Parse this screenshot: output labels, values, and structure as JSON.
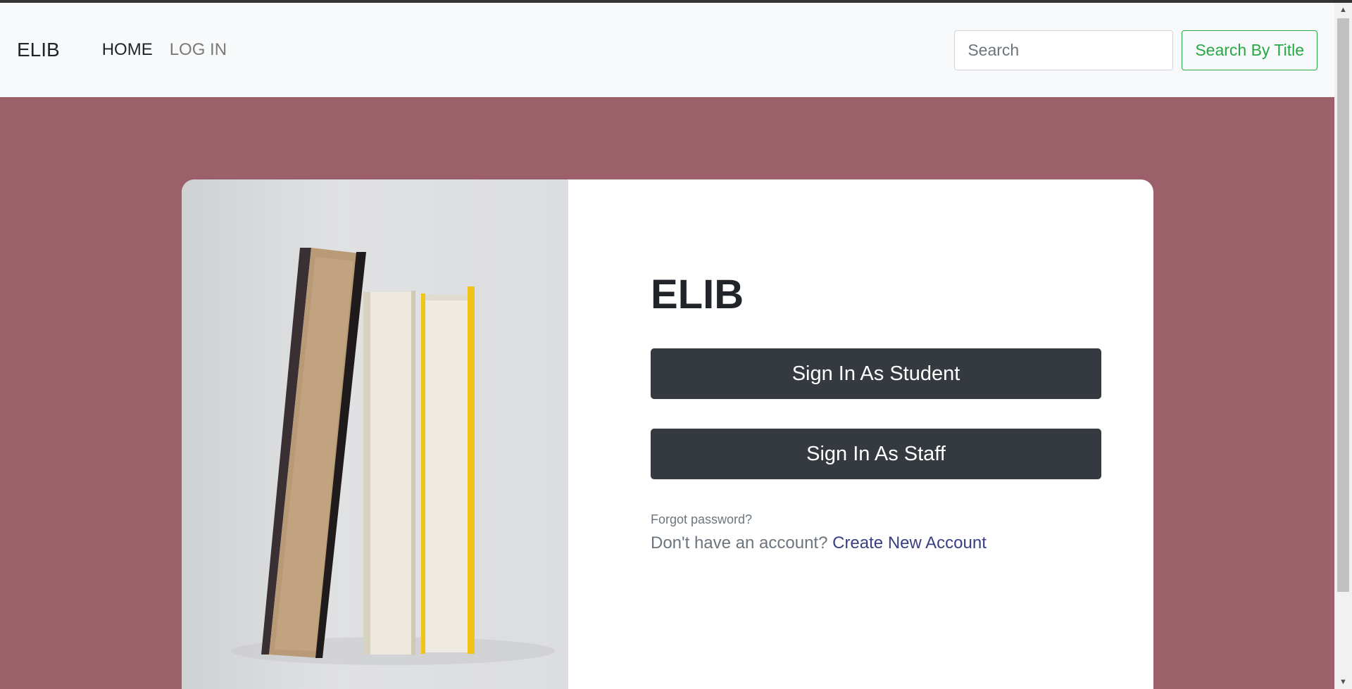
{
  "navbar": {
    "brand": "ELIB",
    "links": {
      "home": "HOME",
      "login": "LOG IN"
    },
    "search": {
      "placeholder": "Search",
      "button": "Search By Title"
    }
  },
  "card": {
    "title": "ELIB",
    "student_button": "Sign In As Student",
    "staff_button": "Sign In As Staff",
    "forgot_password": "Forgot password?",
    "signup_prompt": "Don't have an account?",
    "signup_link": "Create New Account",
    "image_alt": "books-photo"
  },
  "colors": {
    "page_background": "#9b606a",
    "navbar_background": "#f8f9fa",
    "button_dark": "#343a40",
    "search_button_accent": "#28a745",
    "link": "#393f81"
  }
}
